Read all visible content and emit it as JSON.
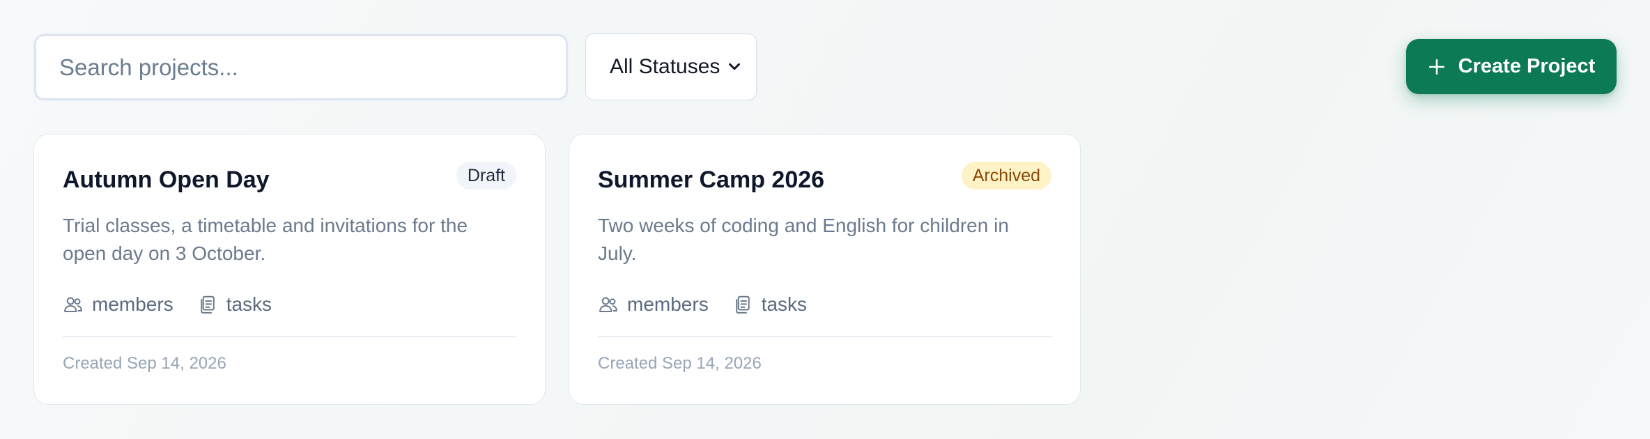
{
  "toolbar": {
    "search_placeholder": "Search projects...",
    "status_filter": {
      "selected": "All Statuses"
    },
    "create_button_label": "Create Project"
  },
  "projects": [
    {
      "title": "Autumn Open Day",
      "status": "Draft",
      "description": "Trial classes, a timetable and invitations for the open day on 3 October.",
      "members_label": "members",
      "tasks_label": "tasks",
      "created": "Created Sep 14, 2026"
    },
    {
      "title": "Summer Camp 2026",
      "status": "Archived",
      "description": "Two weeks of coding and English for children in July.",
      "members_label": "members",
      "tasks_label": "tasks",
      "created": "Created Sep 14, 2026"
    }
  ],
  "icons": {
    "members": "users-icon",
    "tasks": "clipboard-icon",
    "create": "plus-icon",
    "select": "chevron-down-icon"
  },
  "colors": {
    "accent": "#0b7a55",
    "draft_badge_bg": "#f1f5f9",
    "archived_badge_bg": "#fef3c7",
    "archived_badge_text": "#8a4b08"
  }
}
